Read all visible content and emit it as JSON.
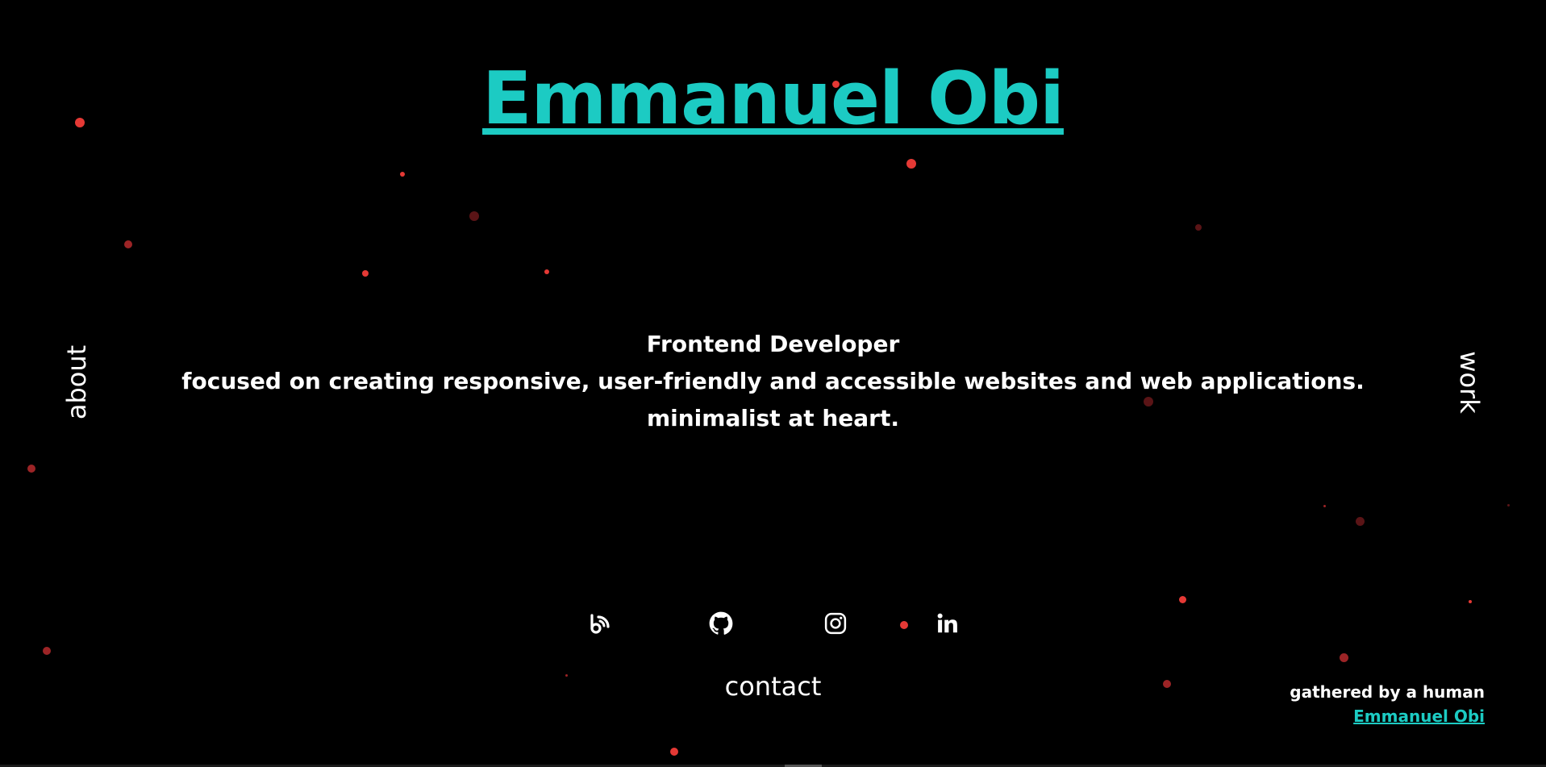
{
  "header": {
    "name": "Emmanuel Obi"
  },
  "nav": {
    "about": "about",
    "work": "work",
    "contact": "contact"
  },
  "intro": {
    "role": "Frontend Developer",
    "focus": "focused on creating responsive, user-friendly and accessible websites and web applications.",
    "motto": "minimalist at heart."
  },
  "socials": [
    {
      "name": "blog",
      "icon": "blog-icon"
    },
    {
      "name": "github",
      "icon": "github-icon"
    },
    {
      "name": "instagram",
      "icon": "instagram-icon"
    },
    {
      "name": "linkedin",
      "icon": "linkedin-icon"
    }
  ],
  "footer": {
    "credit_line": "gathered by a human",
    "credit_name": "Emmanuel Obi"
  },
  "colors": {
    "background": "#000000",
    "accent": "#1ccbc3",
    "text": "#ffffff",
    "particle": "#e53935"
  }
}
